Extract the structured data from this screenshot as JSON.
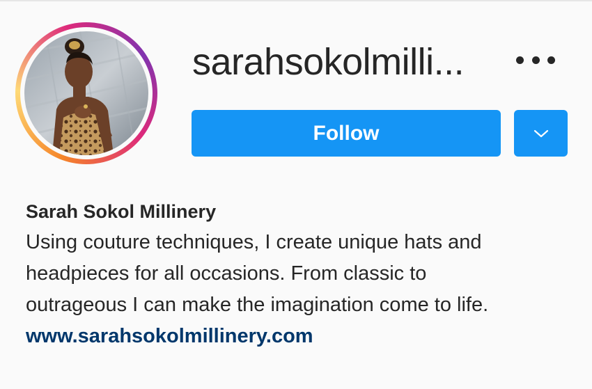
{
  "profile": {
    "username": "sarahsokolmilli...",
    "follow_label": "Follow",
    "avatar_alt": "Sarah Sokol Millinery",
    "icons": {
      "more": "more-options-icon",
      "dropdown": "chevron-down-icon"
    }
  },
  "bio": {
    "name": "Sarah Sokol Millinery",
    "lines": [
      "Using couture techniques, I create unique hats and",
      "headpieces for all occasions. From classic to",
      "outrageous I can make the imagination come to life."
    ],
    "link": "www.sarahsokolmillinery.com"
  },
  "colors": {
    "primary_button": "#1595f5",
    "link": "#00376b",
    "text": "#262626",
    "background": "#fafafa"
  }
}
